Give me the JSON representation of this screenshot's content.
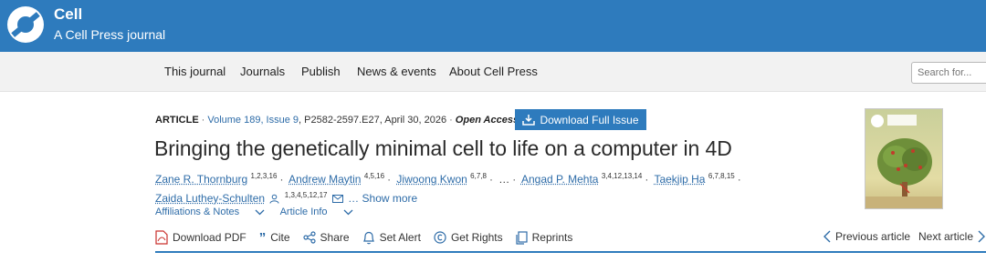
{
  "brand": {
    "title": "Cell",
    "subtitle": "A Cell Press journal",
    "color": "#2e7bbd"
  },
  "nav": {
    "items": [
      "This journal",
      "Journals",
      "Publish",
      "News & events",
      "About Cell Press"
    ],
    "search_placeholder": "Search for..."
  },
  "article": {
    "type": "ARTICLE",
    "volume": "Volume 189, Issue 9",
    "pages": "P2582-2597.E27, April 30, 2026",
    "access": "Open Access",
    "download_issue": "Download Full Issue",
    "title": "Bringing the genetically minimal cell to life on a computer in 4D",
    "authors": [
      {
        "name": "Zane R. Thornburg",
        "sup": "1,2,3,16"
      },
      {
        "name": "Andrew Maytin",
        "sup": "4,5,16"
      },
      {
        "name": "Jiwoong Kwon",
        "sup": "6,7,8"
      },
      {
        "name": "Angad P. Mehta",
        "sup": "3,4,12,13,14"
      },
      {
        "name": "Taekjip Ha",
        "sup": "6,7,8,15"
      },
      {
        "name": "Zaida Luthey-Schulten",
        "sup": "1,3,4,5,12,17"
      }
    ],
    "ellipsis": "…",
    "show_more": "Show more",
    "affiliations_label": "Affiliations & Notes",
    "article_info_label": "Article Info"
  },
  "toolbar": {
    "download_pdf": "Download PDF",
    "cite": "Cite",
    "share": "Share",
    "set_alert": "Set Alert",
    "get_rights": "Get Rights",
    "reprints": "Reprints",
    "previous": "Previous article",
    "next": "Next article"
  },
  "icons": [
    "cell-logo-icon",
    "download-icon",
    "pdf-icon",
    "quote-icon",
    "share-icon",
    "bell-icon",
    "copyright-icon",
    "reprints-icon",
    "person-icon",
    "email-icon",
    "chevron-down-icon",
    "chevron-left-icon",
    "chevron-right-icon"
  ]
}
